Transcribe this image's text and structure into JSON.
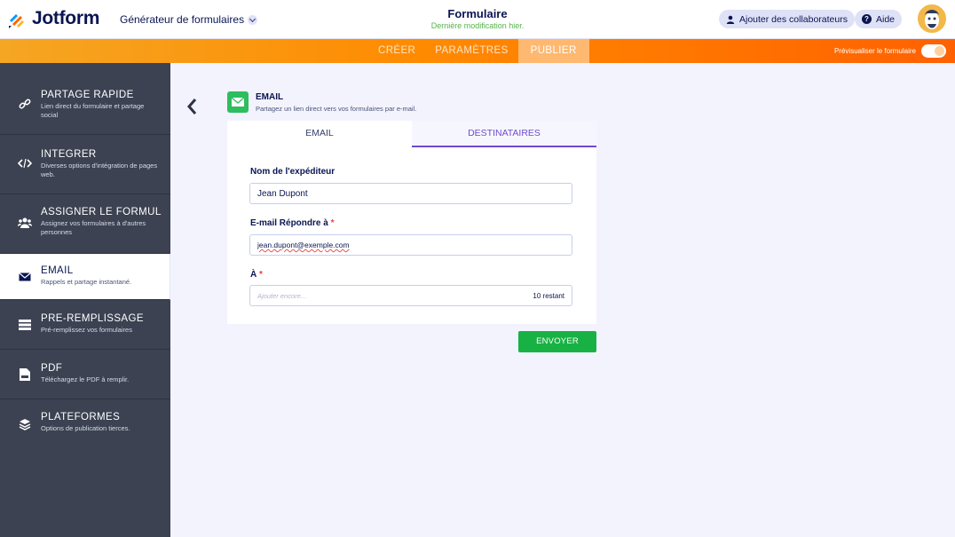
{
  "app": {
    "brand": "Jotform",
    "builder_menu": "Générateur de formulaires",
    "form_title": "Formulaire",
    "last_modified": "Dernière modification hier.",
    "collab_label": "Ajouter des collaborateurs",
    "help_label": "Aide"
  },
  "nav": {
    "tabs": [
      "CRÉER",
      "PARAMÈTRES",
      "PUBLIER"
    ],
    "active_tab": "PUBLIER",
    "preview_label": "Prévisualiser le formulaire"
  },
  "sidebar": {
    "items": [
      {
        "title": "PARTAGE RAPIDE",
        "desc": "Lien direct du formulaire et partage social",
        "icon": "link-icon"
      },
      {
        "title": "INTÉGRER",
        "desc": "Diverses options d'intégration de pages web.",
        "icon": "code-icon"
      },
      {
        "title": "ASSIGNER LE FORMULAI...",
        "desc": "Assignez vos formulaires à d'autres personnes",
        "icon": "users-icon"
      },
      {
        "title": "EMAIL",
        "desc": "Rappels et partage instantané.",
        "icon": "envelope-icon"
      },
      {
        "title": "PRÉ-REMPLISSAGE",
        "desc": "Pré-remplissez vos formulaires",
        "icon": "prefill-icon"
      },
      {
        "title": "PDF",
        "desc": "Téléchargez le PDF à remplir.",
        "icon": "pdf-icon"
      },
      {
        "title": "PLATEFORMES",
        "desc": "Options de publication tierces.",
        "icon": "layers-icon"
      }
    ]
  },
  "main": {
    "section_title": "EMAIL",
    "section_subtitle": "Partagez un lien direct vers vos formulaires par e-mail.",
    "tabs": [
      "EMAIL",
      "DESTINATAIRES"
    ],
    "fields": {
      "sender_label": "Nom de l'expéditeur",
      "sender_value": "Jean Dupont",
      "reply_label": "E-mail Répondre à",
      "reply_value": "jean.dupont@exemple.com",
      "to_label": "À",
      "to_placeholder": "Ajouter encore...",
      "to_remaining": "10 restant",
      "required_mark": "*"
    },
    "send_button": "ENVOYER"
  },
  "colors": {
    "accent_orange": "#ff6100",
    "sidebar_bg": "#3c4252",
    "active_tab_purple": "#7049cf",
    "send_green": "#18b244",
    "email_icon_green": "#2ebd5f"
  }
}
